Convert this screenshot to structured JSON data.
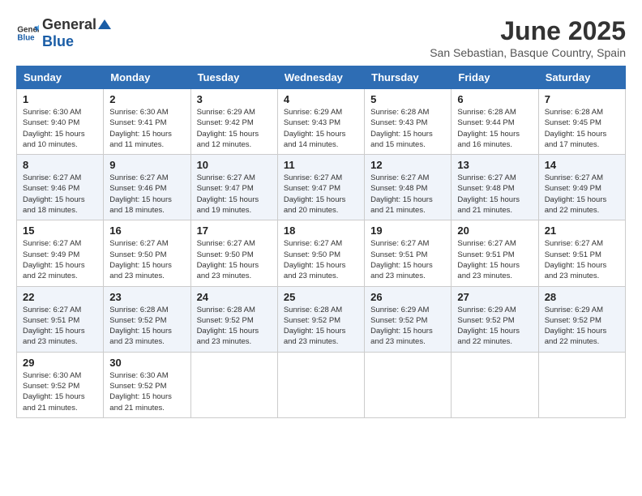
{
  "header": {
    "logo_general": "General",
    "logo_blue": "Blue",
    "month_title": "June 2025",
    "location": "San Sebastian, Basque Country, Spain"
  },
  "calendar": {
    "headers": [
      "Sunday",
      "Monday",
      "Tuesday",
      "Wednesday",
      "Thursday",
      "Friday",
      "Saturday"
    ],
    "weeks": [
      [
        {
          "day": "",
          "info": ""
        },
        {
          "day": "2",
          "info": "Sunrise: 6:30 AM\nSunset: 9:41 PM\nDaylight: 15 hours and 11 minutes."
        },
        {
          "day": "3",
          "info": "Sunrise: 6:29 AM\nSunset: 9:42 PM\nDaylight: 15 hours and 12 minutes."
        },
        {
          "day": "4",
          "info": "Sunrise: 6:29 AM\nSunset: 9:43 PM\nDaylight: 15 hours and 14 minutes."
        },
        {
          "day": "5",
          "info": "Sunrise: 6:28 AM\nSunset: 9:43 PM\nDaylight: 15 hours and 15 minutes."
        },
        {
          "day": "6",
          "info": "Sunrise: 6:28 AM\nSunset: 9:44 PM\nDaylight: 15 hours and 16 minutes."
        },
        {
          "day": "7",
          "info": "Sunrise: 6:28 AM\nSunset: 9:45 PM\nDaylight: 15 hours and 17 minutes."
        }
      ],
      [
        {
          "day": "1",
          "info": "Sunrise: 6:30 AM\nSunset: 9:40 PM\nDaylight: 15 hours and 10 minutes."
        },
        null,
        null,
        null,
        null,
        null,
        null
      ],
      [
        {
          "day": "8",
          "info": "Sunrise: 6:27 AM\nSunset: 9:46 PM\nDaylight: 15 hours and 18 minutes."
        },
        {
          "day": "9",
          "info": "Sunrise: 6:27 AM\nSunset: 9:46 PM\nDaylight: 15 hours and 18 minutes."
        },
        {
          "day": "10",
          "info": "Sunrise: 6:27 AM\nSunset: 9:47 PM\nDaylight: 15 hours and 19 minutes."
        },
        {
          "day": "11",
          "info": "Sunrise: 6:27 AM\nSunset: 9:47 PM\nDaylight: 15 hours and 20 minutes."
        },
        {
          "day": "12",
          "info": "Sunrise: 6:27 AM\nSunset: 9:48 PM\nDaylight: 15 hours and 21 minutes."
        },
        {
          "day": "13",
          "info": "Sunrise: 6:27 AM\nSunset: 9:48 PM\nDaylight: 15 hours and 21 minutes."
        },
        {
          "day": "14",
          "info": "Sunrise: 6:27 AM\nSunset: 9:49 PM\nDaylight: 15 hours and 22 minutes."
        }
      ],
      [
        {
          "day": "15",
          "info": "Sunrise: 6:27 AM\nSunset: 9:49 PM\nDaylight: 15 hours and 22 minutes."
        },
        {
          "day": "16",
          "info": "Sunrise: 6:27 AM\nSunset: 9:50 PM\nDaylight: 15 hours and 23 minutes."
        },
        {
          "day": "17",
          "info": "Sunrise: 6:27 AM\nSunset: 9:50 PM\nDaylight: 15 hours and 23 minutes."
        },
        {
          "day": "18",
          "info": "Sunrise: 6:27 AM\nSunset: 9:50 PM\nDaylight: 15 hours and 23 minutes."
        },
        {
          "day": "19",
          "info": "Sunrise: 6:27 AM\nSunset: 9:51 PM\nDaylight: 15 hours and 23 minutes."
        },
        {
          "day": "20",
          "info": "Sunrise: 6:27 AM\nSunset: 9:51 PM\nDaylight: 15 hours and 23 minutes."
        },
        {
          "day": "21",
          "info": "Sunrise: 6:27 AM\nSunset: 9:51 PM\nDaylight: 15 hours and 23 minutes."
        }
      ],
      [
        {
          "day": "22",
          "info": "Sunrise: 6:27 AM\nSunset: 9:51 PM\nDaylight: 15 hours and 23 minutes."
        },
        {
          "day": "23",
          "info": "Sunrise: 6:28 AM\nSunset: 9:52 PM\nDaylight: 15 hours and 23 minutes."
        },
        {
          "day": "24",
          "info": "Sunrise: 6:28 AM\nSunset: 9:52 PM\nDaylight: 15 hours and 23 minutes."
        },
        {
          "day": "25",
          "info": "Sunrise: 6:28 AM\nSunset: 9:52 PM\nDaylight: 15 hours and 23 minutes."
        },
        {
          "day": "26",
          "info": "Sunrise: 6:29 AM\nSunset: 9:52 PM\nDaylight: 15 hours and 23 minutes."
        },
        {
          "day": "27",
          "info": "Sunrise: 6:29 AM\nSunset: 9:52 PM\nDaylight: 15 hours and 22 minutes."
        },
        {
          "day": "28",
          "info": "Sunrise: 6:29 AM\nSunset: 9:52 PM\nDaylight: 15 hours and 22 minutes."
        }
      ],
      [
        {
          "day": "29",
          "info": "Sunrise: 6:30 AM\nSunset: 9:52 PM\nDaylight: 15 hours and 21 minutes."
        },
        {
          "day": "30",
          "info": "Sunrise: 6:30 AM\nSunset: 9:52 PM\nDaylight: 15 hours and 21 minutes."
        },
        {
          "day": "",
          "info": ""
        },
        {
          "day": "",
          "info": ""
        },
        {
          "day": "",
          "info": ""
        },
        {
          "day": "",
          "info": ""
        },
        {
          "day": "",
          "info": ""
        }
      ]
    ]
  }
}
